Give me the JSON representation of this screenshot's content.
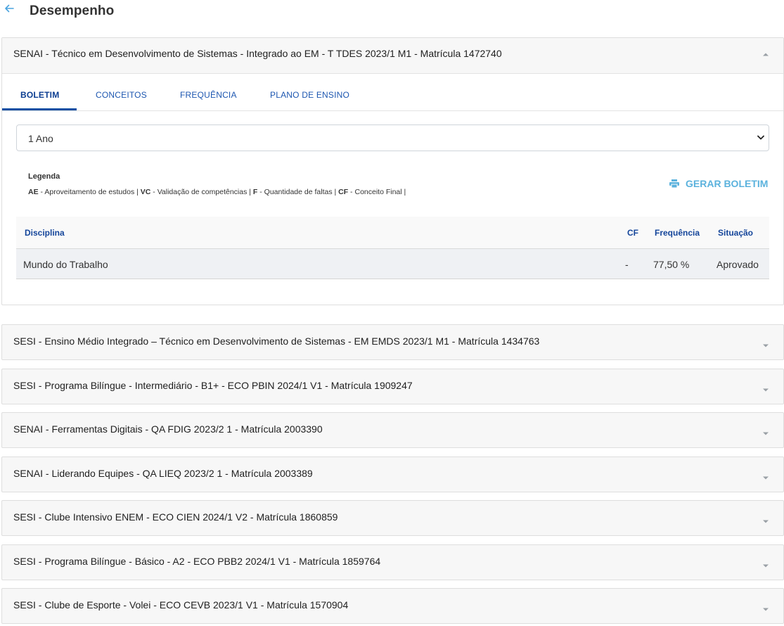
{
  "page": {
    "title": "Desempenho"
  },
  "expanded_panel": {
    "title": "SENAI - Técnico em Desenvolvimento de Sistemas - Integrado ao EM - T TDES 2023/1 M1 - Matrícula 1472740",
    "tabs": [
      "BOLETIM",
      "CONCEITOS",
      "FREQUÊNCIA",
      "PLANO DE ENSINO"
    ],
    "active_tab": "BOLETIM",
    "period_select": {
      "value": "1 Ano"
    },
    "legend": {
      "title": "Legenda",
      "items": [
        {
          "abbr": "AE",
          "desc": "Aproveitamento de estudos"
        },
        {
          "abbr": "VC",
          "desc": "Validação de competências"
        },
        {
          "abbr": "F",
          "desc": "Quantidade de faltas"
        },
        {
          "abbr": "CF",
          "desc": "Conceito Final"
        }
      ]
    },
    "generate_button": {
      "label": "GERAR BOLETIM",
      "icon": "printer-icon"
    },
    "table": {
      "headers": {
        "discipline": "Disciplina",
        "cf": "CF",
        "frequency": "Frequência",
        "status": "Situação"
      },
      "rows": [
        {
          "discipline": "Mundo do Trabalho",
          "cf": "-",
          "frequency": "77,50 %",
          "status": "Aprovado"
        }
      ]
    }
  },
  "collapsed_panels": [
    "SESI - Ensino Médio Integrado – Técnico em Desenvolvimento de Sistemas - EM EMDS 2023/1 M1 - Matrícula 1434763",
    "SESI - Programa Bilíngue - Intermediário - B1+ - ECO PBIN 2024/1 V1 - Matrícula 1909247",
    "SENAI - Ferramentas Digitais - QA FDIG 2023/2 1 - Matrícula 2003390",
    "SENAI - Liderando Equipes - QA LIEQ 2023/2 1 - Matrícula 2003389",
    "SESI - Clube Intensivo ENEM - ECO CIEN 2024/1 V2 - Matrícula 1860859",
    "SESI - Programa Bilíngue - Básico - A2 - ECO PBB2 2024/1 V1 - Matrícula 1859764",
    "SESI - Clube de Esporte - Volei - ECO CEVB 2023/1 V1 - Matrícula 1570904"
  ],
  "colors": {
    "accent": "#0b4ea2",
    "link": "#1c56b0",
    "button": "#5bb2dd",
    "back_arrow": "#4aa3df"
  }
}
